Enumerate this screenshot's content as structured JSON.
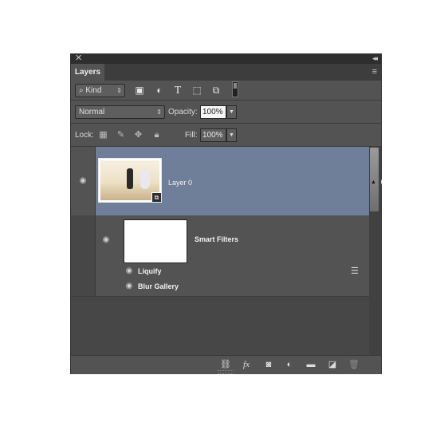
{
  "panel": {
    "close_glyph": "✕",
    "collapse_glyph": "◂◂",
    "tab_label": "Layers",
    "menu_glyph": "≡"
  },
  "filter": {
    "kind_label": "Kind",
    "icons": [
      "image-filter-icon",
      "adjustment-filter-icon",
      "type-filter-icon",
      "shape-filter-icon",
      "smart-object-filter-icon"
    ]
  },
  "blend": {
    "mode": "Normal",
    "opacity_label": "Opacity:",
    "opacity_value": "100%"
  },
  "lock": {
    "label": "Lock:",
    "fill_label": "Fill:",
    "fill_value": "100%"
  },
  "layers": [
    {
      "name": "Layer 0",
      "type": "smart-object",
      "selected": true,
      "visible": true
    }
  ],
  "smart_filters": {
    "label": "Smart Filters",
    "items": [
      {
        "name": "Liquify"
      },
      {
        "name": "Blur Gallery"
      }
    ]
  },
  "footer": {
    "buttons": [
      "link-layers-icon",
      "fx-icon",
      "add-mask-icon",
      "new-adjustment-icon",
      "new-group-icon",
      "new-layer-icon",
      "delete-layer-icon"
    ]
  },
  "colors": {
    "panel": "#535353",
    "selected_row": "#6f7f99",
    "titlebar": "#2e2e2e"
  }
}
